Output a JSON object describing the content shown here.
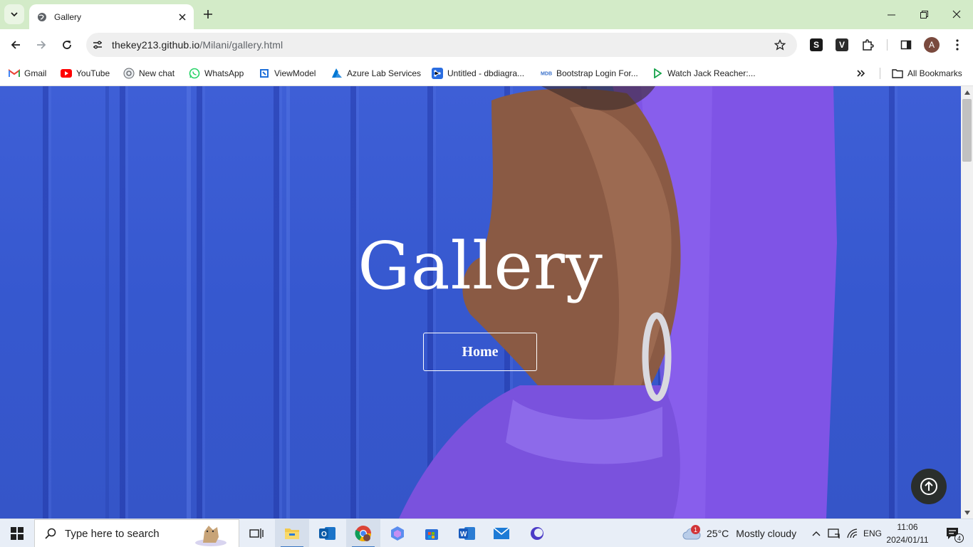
{
  "browser": {
    "tab": {
      "title": "Gallery"
    },
    "url": {
      "host": "thekey213.github.io",
      "path": "/Milani/gallery.html"
    },
    "bookmarks": [
      {
        "label": "Gmail",
        "icon": "gmail-icon"
      },
      {
        "label": "YouTube",
        "icon": "youtube-icon"
      },
      {
        "label": "New chat",
        "icon": "chatgpt-icon"
      },
      {
        "label": "WhatsApp",
        "icon": "whatsapp-icon"
      },
      {
        "label": "ViewModel",
        "icon": "viewmodel-icon"
      },
      {
        "label": "Azure Lab Services",
        "icon": "azure-icon"
      },
      {
        "label": "Untitled - dbdiagra...",
        "icon": "dbdiagram-icon"
      },
      {
        "label": "Bootstrap Login For...",
        "icon": "mdb-icon"
      },
      {
        "label": "Watch Jack Reacher:...",
        "icon": "play-icon"
      }
    ],
    "all_bookmarks_label": "All Bookmarks",
    "profile_initial": "A",
    "extensions": [
      {
        "letter": "S",
        "color": "#1a1a1a"
      },
      {
        "letter": "V",
        "color": "#2b2b2b"
      }
    ]
  },
  "page": {
    "hero_title": "Gallery",
    "home_button": "Home",
    "colors": {
      "background": "#3658cf",
      "scroll_top_button": "#2a2e2c"
    }
  },
  "taskbar": {
    "search_placeholder": "Type here to search",
    "weather": {
      "temp": "25°C",
      "condition": "Mostly cloudy",
      "badge": "1"
    },
    "language": "ENG",
    "time": "11:06",
    "date": "2024/01/11",
    "notification_count": "4"
  }
}
